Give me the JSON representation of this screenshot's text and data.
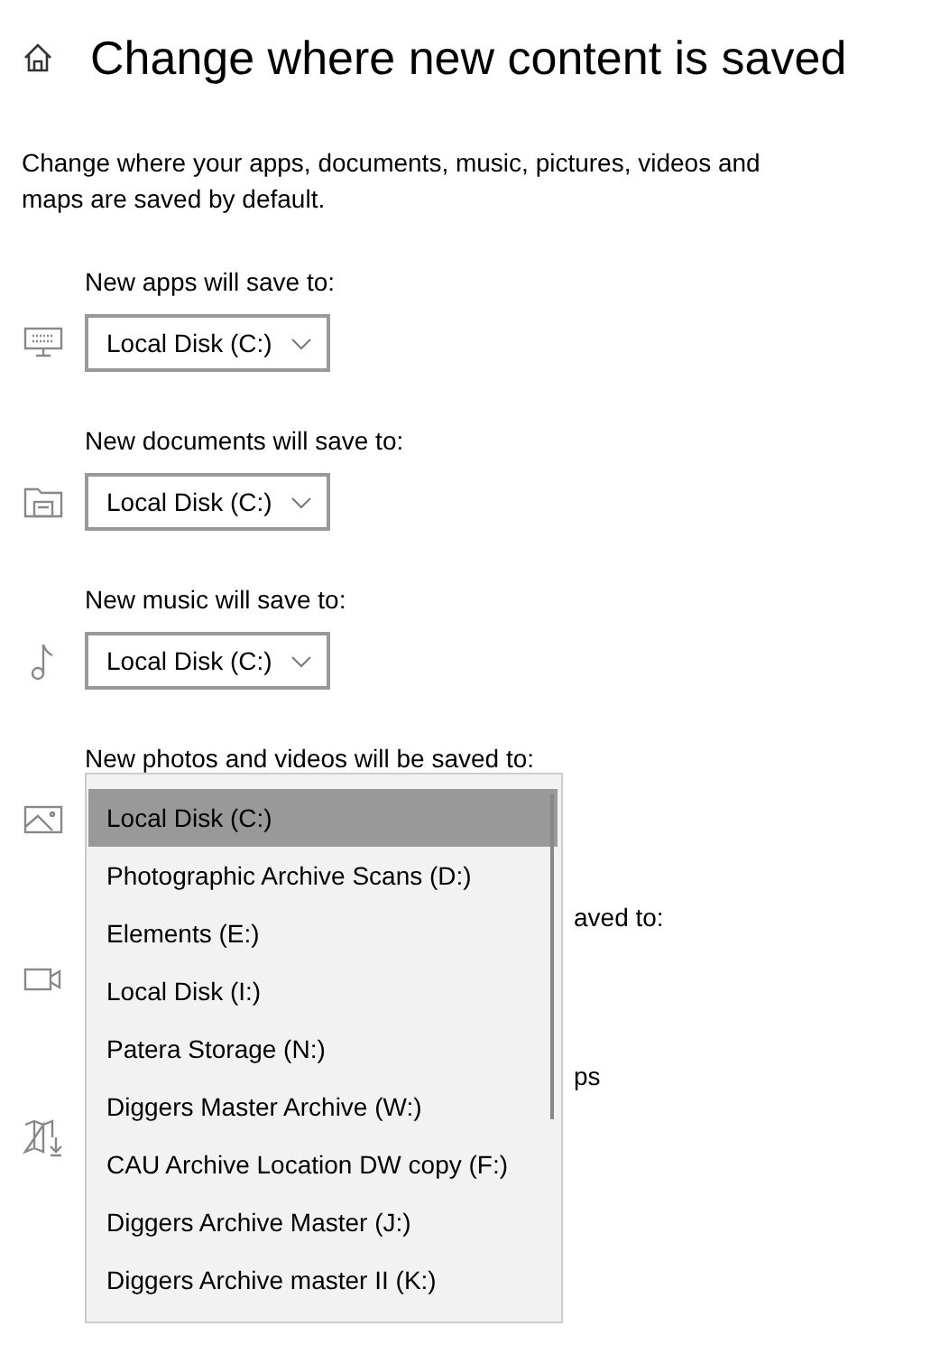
{
  "title": "Change where new content is saved",
  "description": "Change where your apps, documents, music, pictures, videos and maps are saved by default.",
  "locations": [
    {
      "kind": "combo",
      "label": "New apps will save to:",
      "value": "Local Disk (C:)"
    },
    {
      "kind": "combo",
      "label": "New documents will save to:",
      "value": "Local Disk (C:)"
    },
    {
      "kind": "combo",
      "label": "New music will save to:",
      "value": "Local Disk (C:)"
    },
    {
      "kind": "open",
      "label": "New photos and videos will be saved to:",
      "options": [
        {
          "text": "Local Disk (C:)",
          "selected": true
        },
        {
          "text": "Photographic Archive Scans (D:)",
          "selected": false
        },
        {
          "text": "Elements (E:)",
          "selected": false
        },
        {
          "text": "Local Disk (I:)",
          "selected": false
        },
        {
          "text": "Patera Storage (N:)",
          "selected": false
        },
        {
          "text": "Diggers Master Archive (W:)",
          "selected": false
        },
        {
          "text": "CAU Archive Location DW copy (F:)",
          "selected": false
        },
        {
          "text": "Diggers Archive Master (J:)",
          "selected": false
        },
        {
          "text": "Diggers Archive master II (K:)",
          "selected": false
        }
      ]
    },
    {
      "kind": "covered",
      "label": "aved to:"
    },
    {
      "kind": "covered",
      "label": "ps"
    }
  ]
}
